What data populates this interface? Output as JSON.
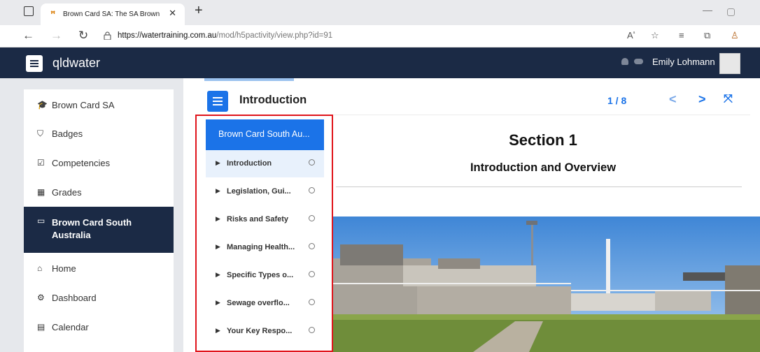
{
  "browser": {
    "tab_title": "Brown Card SA: The SA Brown C",
    "tab_close": "✕",
    "new_tab": "+",
    "url_host": "https://watertraining.com.au",
    "url_path": "/mod/h5pactivity/view.php?id=91"
  },
  "navbar": {
    "brand": "qldwater",
    "username": "Emily Lohmann"
  },
  "drawer": {
    "items": [
      {
        "icon": "graduation-cap-icon",
        "label": "Brown Card SA"
      },
      {
        "icon": "shield-icon",
        "label": "Badges"
      },
      {
        "icon": "checkbox-icon",
        "label": "Competencies"
      },
      {
        "icon": "table-icon",
        "label": "Grades"
      },
      {
        "icon": "folder-icon",
        "label": "Brown Card South Australia",
        "active": true
      },
      {
        "icon": "home-icon",
        "label": "Home"
      },
      {
        "icon": "dashboard-icon",
        "label": "Dashboard"
      },
      {
        "icon": "calendar-icon",
        "label": "Calendar"
      }
    ]
  },
  "h5p": {
    "chapter_title": "Introduction",
    "page_count": "1 / 8",
    "nav_top": "Brown Card South Au...",
    "chapters": [
      "Introduction",
      "Legislation, Gui...",
      "Risks and Safety",
      "Managing Health...",
      "Specific Types o...",
      "Sewage overflo...",
      "Your Key Respo..."
    ],
    "current_chapter": 0
  },
  "content": {
    "section_title": "Section 1",
    "section_subtitle": "Introduction and Overview"
  },
  "colors": {
    "navbar": "#1b2a45",
    "accent": "#1b73e8",
    "highlight_box": "#e0141b"
  }
}
